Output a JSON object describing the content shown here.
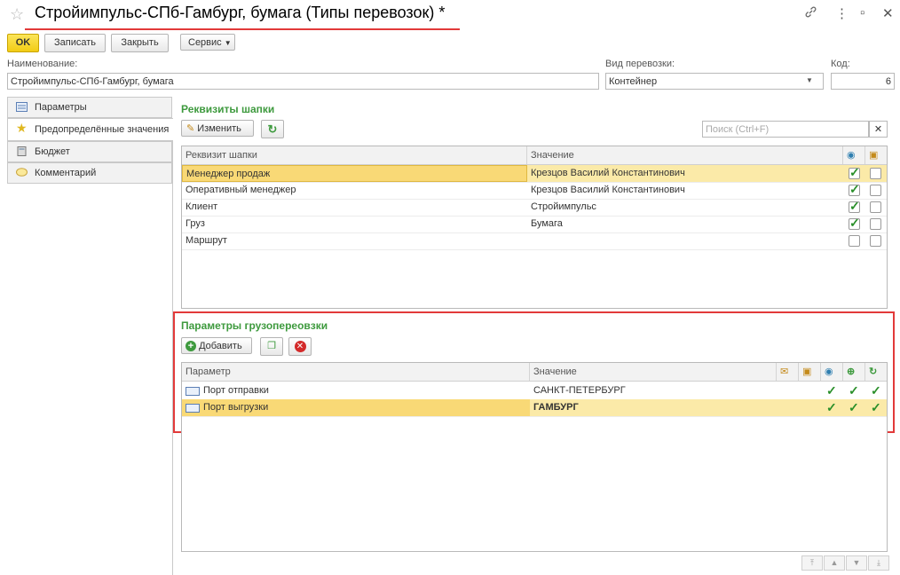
{
  "window": {
    "title": "Стройимпульс-СПб-Гамбург, бумага (Типы перевозок) *"
  },
  "toolbar": {
    "ok_label": "OK",
    "save_label": "Записать",
    "close_label": "Закрыть",
    "service_label": "Сервис"
  },
  "form": {
    "name_label": "Наименование:",
    "name_value": "Стройимпульс-СПб-Гамбург, бумага",
    "transport_label": "Вид перевозки:",
    "transport_value": "Контейнер",
    "code_label": "Код:",
    "code_value": "6"
  },
  "sidebar": {
    "items": [
      {
        "label": "Параметры",
        "icon": "list-icon"
      },
      {
        "label": "Предопределённые значения",
        "icon": "star-icon"
      },
      {
        "label": "Бюджет",
        "icon": "calculator-icon"
      },
      {
        "label": "Комментарий",
        "icon": "comment-icon"
      }
    ]
  },
  "header_section": {
    "title": "Реквизиты шапки",
    "edit_label": "Изменить",
    "search_placeholder": "Поиск (Ctrl+F)",
    "columns": [
      "Реквизит шапки",
      "Значение"
    ],
    "rows": [
      {
        "name": "Менеджер продаж",
        "value": "Крезцов Василий Константинович",
        "check1": true,
        "check2": false
      },
      {
        "name": "Оперативный менеджер",
        "value": "Крезцов Василий Константинович",
        "check1": true,
        "check2": false
      },
      {
        "name": "Клиент",
        "value": "Стройимпульс",
        "check1": true,
        "check2": false
      },
      {
        "name": "Груз",
        "value": "Бумага",
        "check1": true,
        "check2": false
      },
      {
        "name": "Маршрут",
        "value": "",
        "check1": false,
        "check2": false
      }
    ]
  },
  "params_section": {
    "title": "Параметры грузопереовзки",
    "add_label": "Добавить",
    "columns": [
      "Параметр",
      "Значение"
    ],
    "rows": [
      {
        "name": "Порт отправки",
        "value": "САНКТ-ПЕТЕРБУРГ"
      },
      {
        "name": "Порт выгрузки",
        "value": "ГАМБУРГ"
      }
    ]
  },
  "colors": {
    "accent_green": "#3e9a3e",
    "ok_yellow": "#f2cc14",
    "selection": "#fbeaa8",
    "highlight_red": "#e23a3a"
  }
}
